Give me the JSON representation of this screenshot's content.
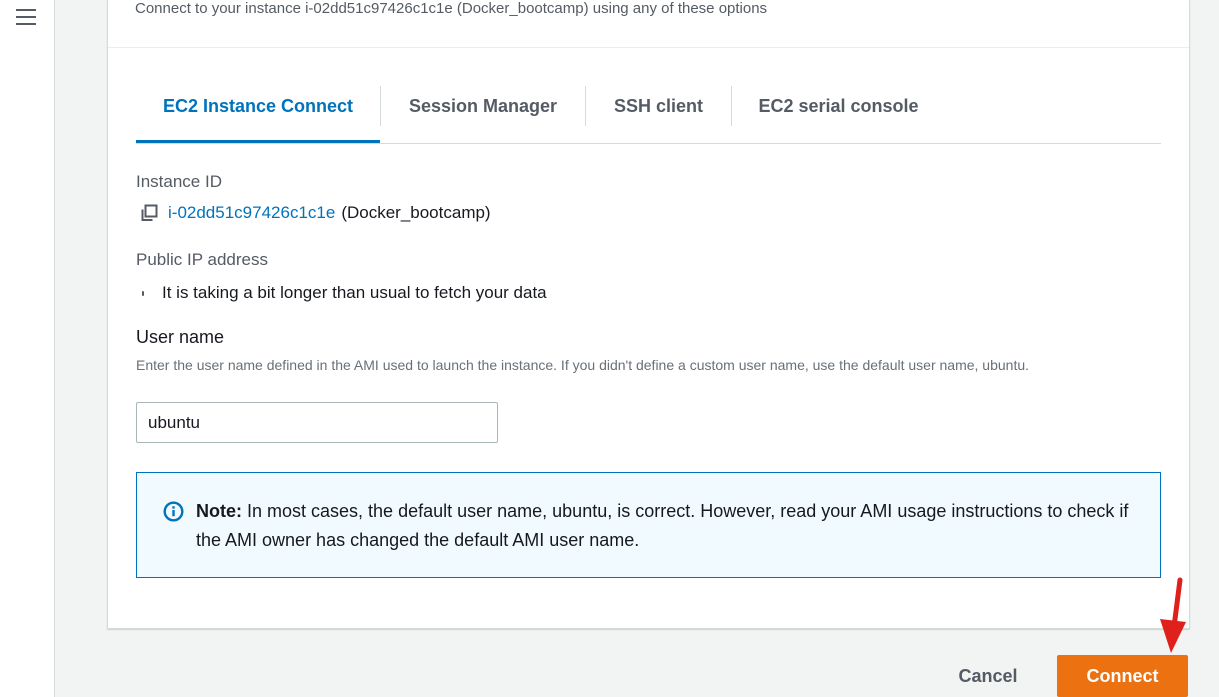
{
  "header": {
    "subtitle": "Connect to your instance i-02dd51c97426c1c1e (Docker_bootcamp) using any of these options"
  },
  "tabs": [
    {
      "label": "EC2 Instance Connect",
      "active": true
    },
    {
      "label": "Session Manager",
      "active": false
    },
    {
      "label": "SSH client",
      "active": false
    },
    {
      "label": "EC2 serial console",
      "active": false
    }
  ],
  "instance": {
    "label": "Instance ID",
    "id": "i-02dd51c97426c1c1e",
    "name": "(Docker_bootcamp)"
  },
  "public_ip": {
    "label": "Public IP address",
    "status": "It is taking a bit longer than usual to fetch your data"
  },
  "username": {
    "label": "User name",
    "description": "Enter the user name defined in the AMI used to launch the instance. If you didn't define a custom user name, use the default user name, ubuntu.",
    "value": "ubuntu"
  },
  "note": {
    "title": "Note:",
    "body": " In most cases, the default user name, ubuntu, is correct. However, read your AMI usage instructions to check if the AMI owner has changed the default AMI user name."
  },
  "actions": {
    "cancel": "Cancel",
    "connect": "Connect"
  },
  "colors": {
    "accent": "#0073bb",
    "primary_button": "#ec7211",
    "annotation_arrow": "#e0201b"
  },
  "icons": {
    "menu": "hamburger-menu-icon",
    "copy": "copy-icon",
    "loading": "spinner-icon",
    "info": "info-icon",
    "annotation": "red-arrow-icon"
  }
}
